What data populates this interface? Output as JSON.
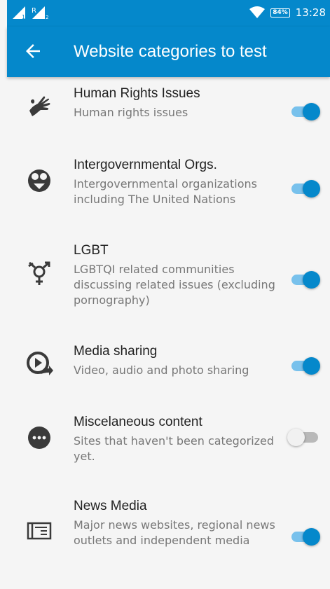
{
  "status_bar": {
    "signal1_label": "1",
    "signal2_label": "R",
    "signal2_sub": "2",
    "battery": "84%",
    "time": "13:28"
  },
  "app_bar": {
    "back_icon": "arrow-back-icon",
    "title": "Website categories to test"
  },
  "colors": {
    "primary": "#0588cb",
    "toggle_track_on": "#78c1ec"
  },
  "categories": [
    {
      "icon": "hand-icon",
      "title": "Human Rights Issues",
      "desc": "Human rights issues",
      "enabled": true
    },
    {
      "icon": "intergovernmental-icon",
      "title": "Intergovernmental Orgs.",
      "desc": "Intergovernmental organizations including The United Nations",
      "enabled": true
    },
    {
      "icon": "gender-symbol-icon",
      "title": "LGBT",
      "desc": "LGBTQI related communities discussing related issues (excluding pornography)",
      "enabled": true
    },
    {
      "icon": "media-share-icon",
      "title": "Media sharing",
      "desc": "Video, audio and photo sharing",
      "enabled": true
    },
    {
      "icon": "more-horizontal-icon",
      "title": "Miscelaneous content",
      "desc": "Sites that haven't been categorized yet.",
      "enabled": false
    },
    {
      "icon": "newspaper-icon",
      "title": "News Media",
      "desc": "Major news websites, regional news outlets and independent media",
      "enabled": true
    }
  ]
}
